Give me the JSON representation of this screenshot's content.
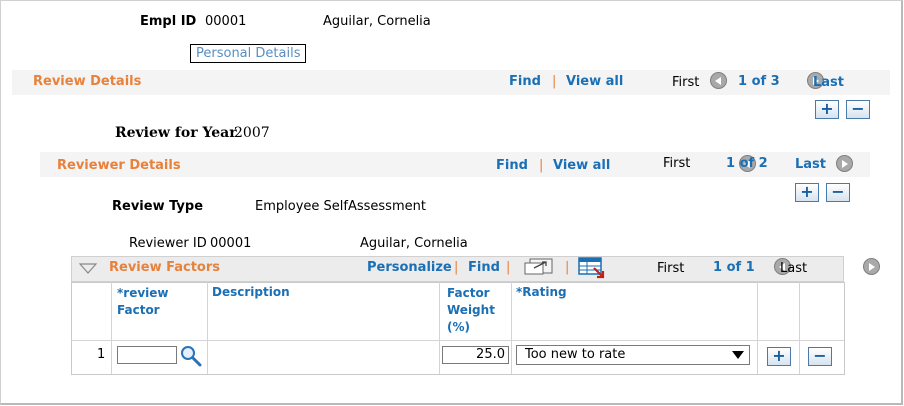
{
  "employee": {
    "empl_id_label": "Empl ID",
    "empl_id": "00001",
    "name": "Aguilar, Cornelia",
    "personal_details_link": "Personal Details"
  },
  "review_details": {
    "title": "Review Details",
    "find": "Find",
    "separator": "|",
    "view_all": "View all",
    "first": "First",
    "counter": "1 of 3",
    "last": "Last",
    "year_label": "Review for Year",
    "year": "2007"
  },
  "reviewer_details": {
    "title": "Reviewer Details",
    "find": "Find",
    "separator": "|",
    "view_all": "View all",
    "first": "First",
    "counter": "1 of 2",
    "last": "Last",
    "review_type_label": "Review Type",
    "review_type": "Employee SelfAssessment",
    "reviewer_id_label": "Reviewer ID",
    "reviewer_id": "00001",
    "reviewer_name": "Aguilar, Cornelia"
  },
  "review_factors": {
    "title": "Review Factors",
    "personalize": "Personalize",
    "separator": "|",
    "find": "Find",
    "first": "First",
    "counter": "1 of 1",
    "last": "Last",
    "columns": {
      "factor_line1": "*review",
      "factor_line2": "Factor",
      "description": "Description",
      "weight_line1": "Factor",
      "weight_line2": "Weight",
      "weight_line3": "(%)",
      "rating": "*Rating"
    },
    "rows": [
      {
        "num": "1",
        "factor": "",
        "description": "",
        "weight": "25.0",
        "rating": "Too new to rate"
      }
    ]
  },
  "buttons": {
    "add": "+",
    "delete": "−"
  },
  "icons": {
    "prev": "prev-icon",
    "next": "next-icon",
    "lookup": "magnifier-icon",
    "view_all_grid": "zoom-grid-icon",
    "download": "download-excel-icon",
    "collapse": "collapse-triangle-icon"
  },
  "colors": {
    "accent": "#e8813a",
    "link": "#1a6fb5",
    "band": "#f4f4f4"
  }
}
